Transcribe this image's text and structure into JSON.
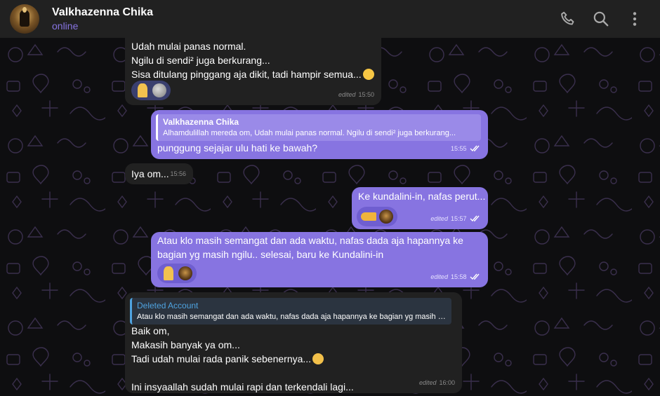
{
  "header": {
    "title": "Valkhazenna Chika",
    "status": "online",
    "icons": [
      "phone-icon",
      "search-icon",
      "more-vert-icon"
    ]
  },
  "colors": {
    "header_bg": "#212121",
    "incoming_bubble": "#212121",
    "outgoing_bubble": "#8774e1",
    "accent": "#8774e1",
    "quote_in": "#4fa3e0"
  },
  "messages": [
    {
      "direction": "in",
      "text": "Udah mulai panas normal.\nNgilu di sendi² juga berkurang...\nSisa ditulang pinggang aja dikit, tadi hampir semua...",
      "emoji": "😖",
      "reactions": [
        "🙏",
        "🌚"
      ],
      "edited": "edited",
      "time": "15:50"
    },
    {
      "direction": "out",
      "reply": {
        "name": "Valkhazenna Chika",
        "text": "Alhamdulillah mereda om, Udah mulai panas normal. Ngilu di sendi² juga berkurang..."
      },
      "text": "punggung sejajar ulu hati ke bawah?",
      "time": "15:55",
      "read": true
    },
    {
      "direction": "in",
      "text": "Iya om...",
      "time": "15:56"
    },
    {
      "direction": "out",
      "text": "Ke kundalini-in, nafas perut...",
      "reactions": [
        "👈",
        "sticker"
      ],
      "edited": "edited",
      "time": "15:57",
      "read": true
    },
    {
      "direction": "out",
      "text": "Atau klo masih semangat dan ada waktu, nafas dada aja hapannya ke bagian yg masih ngilu.. selesai, baru ke Kundalini-in",
      "reactions": [
        "🙏",
        "sticker"
      ],
      "edited": "edited",
      "time": "15:58",
      "read": true
    },
    {
      "direction": "in",
      "reply": {
        "name": "Deleted Account",
        "text": "Atau klo masih semangat dan ada waktu, nafas dada aja hapannya ke bagian yg masih ngilu.."
      },
      "text_lines": [
        "Baik om,",
        "Makasih banyak ya om...",
        "Tadi udah mulai rada panik sebenernya...",
        "",
        "Ini insyaallah sudah mulai rapi dan terkendali lagi..."
      ],
      "emoji": "😨",
      "edited": "edited",
      "time": "16:00"
    }
  ]
}
